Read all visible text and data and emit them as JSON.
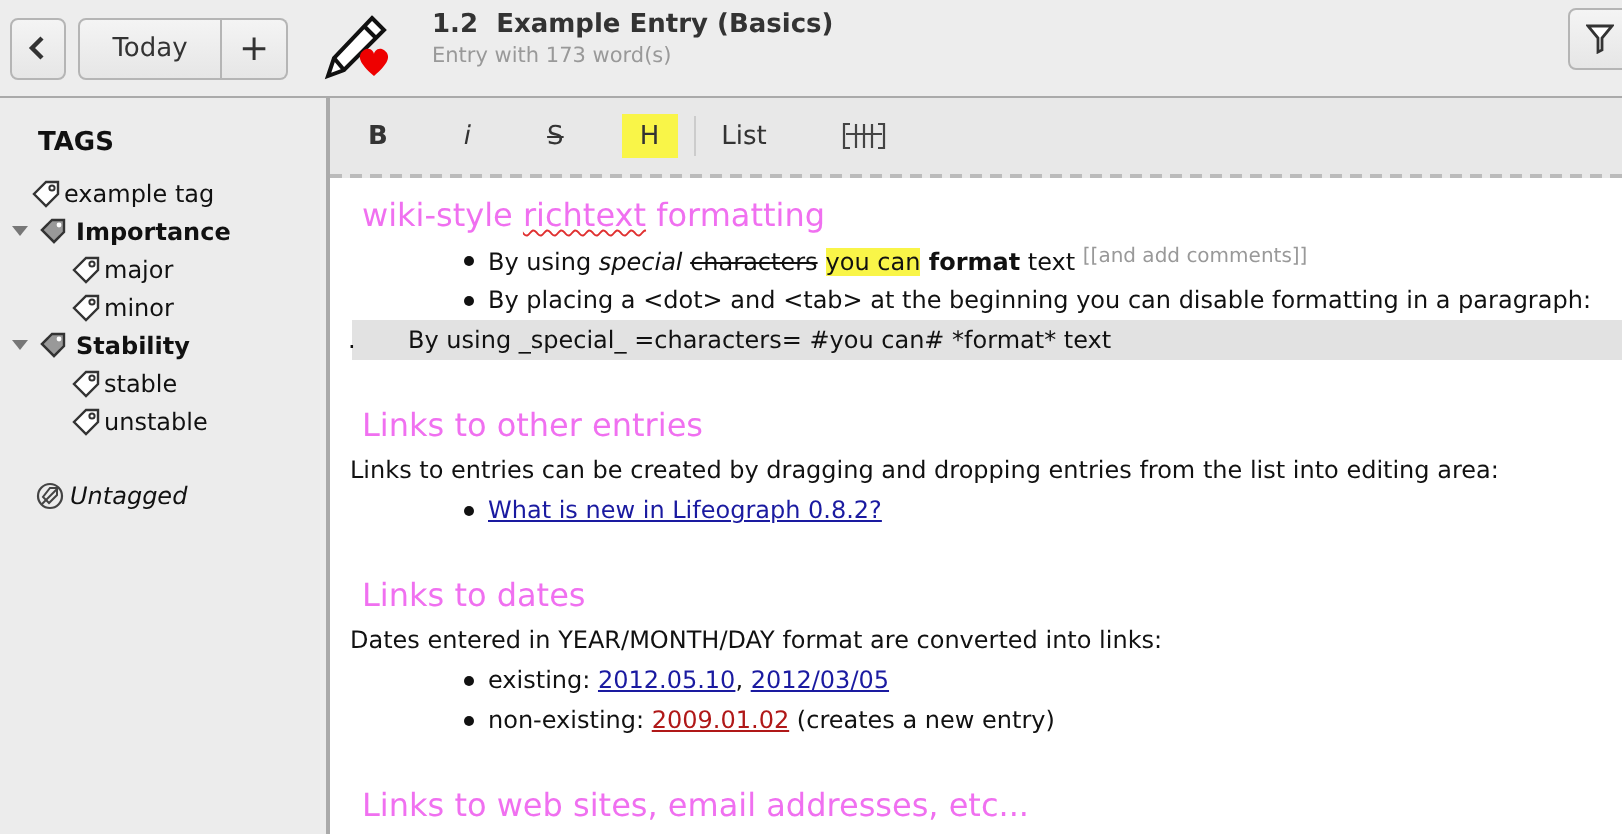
{
  "header": {
    "today": "Today",
    "add": "+",
    "title": "1.2  Example Entry (Basics)",
    "subtitle": "Entry with 173 word(s)"
  },
  "sidebar": {
    "title": "TAGS",
    "tags": [
      {
        "label": "example tag",
        "kind": "tag"
      },
      {
        "label": "Importance",
        "kind": "category",
        "expanded": true,
        "children": [
          {
            "label": "major",
            "kind": "tag"
          },
          {
            "label": "minor",
            "kind": "tag"
          }
        ]
      },
      {
        "label": "Stability",
        "kind": "category",
        "expanded": true,
        "children": [
          {
            "label": "stable",
            "kind": "tag"
          },
          {
            "label": "unstable",
            "kind": "tag"
          }
        ]
      }
    ],
    "untagged": "Untagged"
  },
  "toolbar": [
    {
      "label": "B",
      "kind": "bold"
    },
    {
      "label": "i",
      "kind": "italic"
    },
    {
      "label": "S",
      "kind": "strike"
    },
    {
      "label": "H",
      "kind": "highlight"
    },
    {
      "label": "List",
      "kind": "list"
    },
    {
      "kind": "ignore"
    }
  ],
  "blocks": [
    {
      "kind": "heading",
      "segments": [
        {
          "text": "wiki-style ",
          "kind": "plain"
        },
        {
          "text": "richtext",
          "kind": "misspelled"
        },
        {
          "text": " formatting",
          "kind": "plain"
        }
      ]
    },
    {
      "kind": "bullet",
      "segments": [
        {
          "text": "By using ",
          "kind": "plain"
        },
        {
          "text": "special ",
          "kind": "italic"
        },
        {
          "text": "characters",
          "kind": "strike"
        },
        {
          "text": "you can",
          "kind": "highlight"
        },
        {
          "text": " format",
          "kind": "bold"
        },
        {
          "text": " text ",
          "kind": "plain"
        },
        {
          "text": "[[and add comments]]",
          "kind": "comment"
        }
      ]
    },
    {
      "kind": "bullet",
      "segments": [
        {
          "text": "By placing a <dot> and <tab> at the beginning you can disable formatting in a paragraph:",
          "kind": "plain"
        }
      ]
    },
    {
      "kind": "ignored",
      "marker": ".",
      "segments": [
        {
          "text": "By using _special_ =characters= #you can# *format* text",
          "kind": "plain"
        }
      ]
    },
    {
      "kind": "space"
    },
    {
      "kind": "heading",
      "segments": [
        {
          "text": "Links to other entries",
          "kind": "plain"
        }
      ]
    },
    {
      "kind": "paragraph",
      "segments": [
        {
          "text": "Links to entries can be created by dragging and dropping entries from the list into editing area:",
          "kind": "plain"
        }
      ]
    },
    {
      "kind": "bullet",
      "segments": [
        {
          "text": "What is new in Lifeograph 0.8.2?",
          "kind": "link"
        }
      ]
    },
    {
      "kind": "space"
    },
    {
      "kind": "heading",
      "segments": [
        {
          "text": "Links to dates",
          "kind": "plain"
        }
      ]
    },
    {
      "kind": "paragraph",
      "segments": [
        {
          "text": "Dates entered in YEAR/MONTH/DAY format are converted into links:",
          "kind": "plain"
        }
      ]
    },
    {
      "kind": "bullet",
      "segments": [
        {
          "text": "existing: ",
          "kind": "plain"
        },
        {
          "text": "2012.05.10",
          "kind": "link"
        },
        {
          "text": ", ",
          "kind": "plain"
        },
        {
          "text": "2012/03/05",
          "kind": "link"
        }
      ]
    },
    {
      "kind": "bullet",
      "segments": [
        {
          "text": "non-existing: ",
          "kind": "plain"
        },
        {
          "text": "2009.01.02",
          "kind": "broken-link"
        },
        {
          "text": " (creates a new entry)",
          "kind": "plain"
        }
      ]
    },
    {
      "kind": "space"
    },
    {
      "kind": "heading",
      "segments": [
        {
          "text": "Links to web sites, email addresses, etc...",
          "kind": "plain"
        }
      ]
    }
  ]
}
